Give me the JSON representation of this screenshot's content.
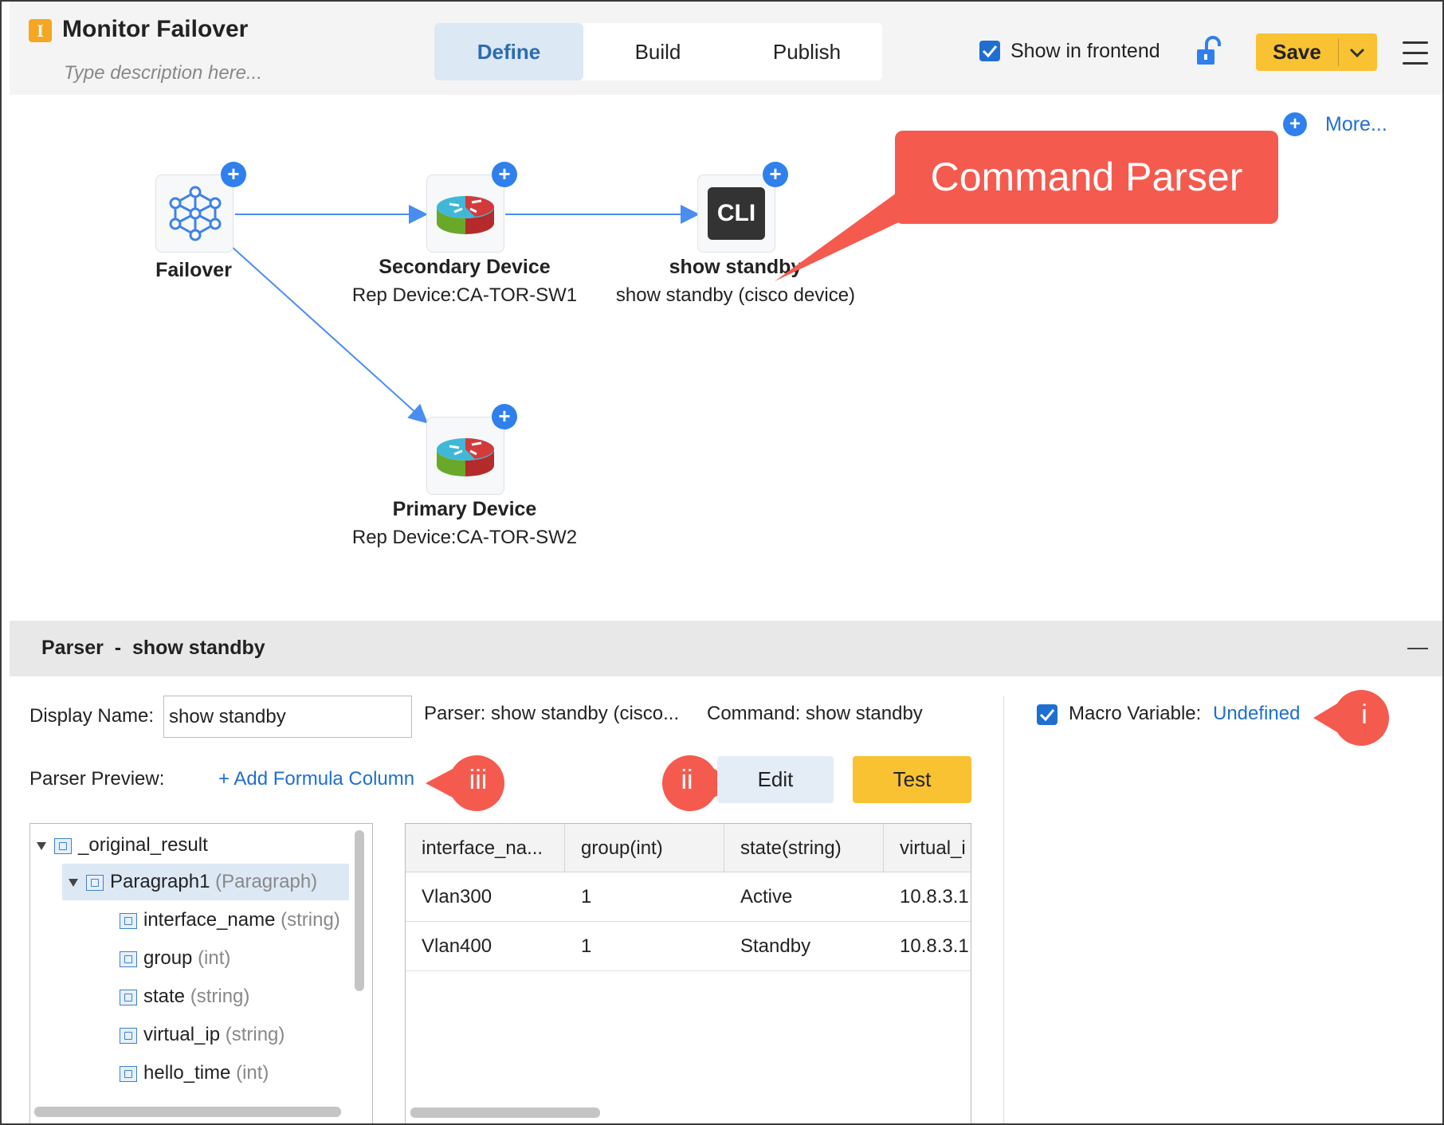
{
  "app": {
    "badge": "I",
    "title": "Monitor Failover",
    "description_placeholder": "Type description here..."
  },
  "tabs": [
    {
      "label": "Define",
      "active": true
    },
    {
      "label": "Build",
      "active": false
    },
    {
      "label": "Publish",
      "active": false
    }
  ],
  "toolbar": {
    "show_in_frontend_label": "Show in frontend",
    "show_in_frontend_checked": true,
    "save_label": "Save"
  },
  "canvas": {
    "more_label": "More...",
    "callout_text": "Command Parser",
    "nodes": [
      {
        "id": "failover",
        "title": "Failover",
        "subtitle": "",
        "icon": "network-hub-icon"
      },
      {
        "id": "secondary",
        "title": "Secondary Device",
        "subtitle": "Rep Device:CA-TOR-SW1",
        "icon": "router-icon"
      },
      {
        "id": "cli",
        "title": "show standby",
        "subtitle": "show standby (cisco device)",
        "icon": "cli-icon",
        "icon_text": "CLI"
      },
      {
        "id": "primary",
        "title": "Primary Device",
        "subtitle": "Rep Device:CA-TOR-SW2",
        "icon": "router-icon"
      }
    ]
  },
  "parser": {
    "panel_title": "Parser  -  show standby",
    "display_name_label": "Display Name:",
    "display_name_value": "show standby",
    "parser_label": "Parser: show standby (cisco...",
    "command_label": "Command: show standby",
    "macro_variable_label": "Macro Variable:",
    "macro_variable_value": "Undefined",
    "macro_variable_checked": true,
    "preview_label": "Parser Preview:",
    "add_formula_label": "+ Add Formula Column",
    "edit_label": "Edit",
    "test_label": "Test",
    "markers": [
      "i",
      "ii",
      "iii"
    ],
    "tree": [
      {
        "name": "_original_result",
        "type": "",
        "level": 0,
        "expanded": true
      },
      {
        "name": "Paragraph1",
        "type": "(Paragraph)",
        "level": 1,
        "expanded": true,
        "selected": true
      },
      {
        "name": "interface_name",
        "type": "(string)",
        "level": 2
      },
      {
        "name": "group",
        "type": "(int)",
        "level": 2
      },
      {
        "name": "state",
        "type": "(string)",
        "level": 2
      },
      {
        "name": "virtual_ip",
        "type": "(string)",
        "level": 2
      },
      {
        "name": "hello_time",
        "type": "(int)",
        "level": 2
      }
    ],
    "table": {
      "columns": [
        "interface_na...",
        "group(int)",
        "state(string)",
        "virtual_i"
      ],
      "rows": [
        [
          "Vlan300",
          "1",
          "Active",
          "10.8.3.1"
        ],
        [
          "Vlan400",
          "1",
          "Standby",
          "10.8.3.1"
        ]
      ]
    }
  },
  "colors": {
    "accent_blue": "#1f6fd1",
    "save_yellow": "#f8c232",
    "callout_red": "#f55a4e",
    "tab_active_bg": "#dce8f4"
  }
}
